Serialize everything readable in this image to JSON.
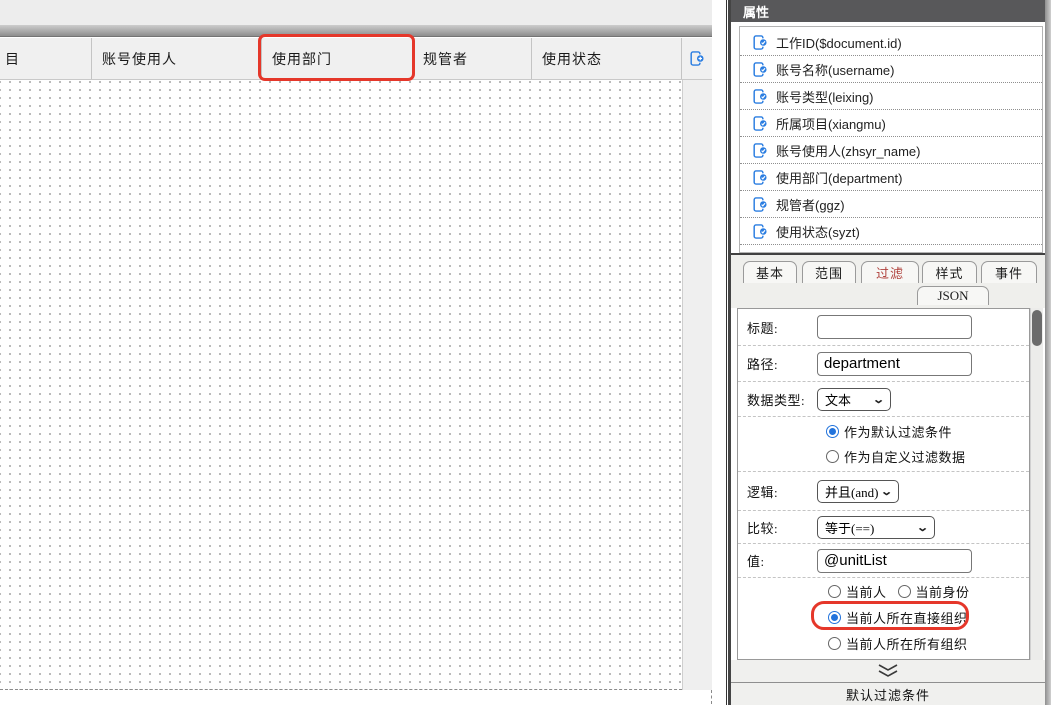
{
  "left_table": {
    "headers": [
      {
        "label": "目"
      },
      {
        "label": "账号使用人"
      },
      {
        "label": "使用部门",
        "highlighted": true
      },
      {
        "label": "规管者"
      },
      {
        "label": "使用状态"
      }
    ],
    "add_column_icon": "page-plus-icon"
  },
  "panel": {
    "title": "属性",
    "fields": [
      {
        "label": "工作ID($document.id)",
        "icon": "page-check-icon"
      },
      {
        "label": "账号名称(username)",
        "icon": "page-check-icon"
      },
      {
        "label": "账号类型(leixing)",
        "icon": "page-check-icon"
      },
      {
        "label": "所属项目(xiangmu)",
        "icon": "page-check-icon"
      },
      {
        "label": "账号使用人(zhsyr_name)",
        "icon": "page-check-icon"
      },
      {
        "label": "使用部门(department)",
        "icon": "page-check-icon"
      },
      {
        "label": "规管者(ggz)",
        "icon": "page-check-icon"
      },
      {
        "label": "使用状态(syzt)",
        "icon": "page-check-icon"
      }
    ],
    "tabs": [
      {
        "label": "基本",
        "active": false
      },
      {
        "label": "范围",
        "active": false
      },
      {
        "label": "过滤",
        "active": true
      },
      {
        "label": "样式",
        "active": false
      },
      {
        "label": "事件",
        "active": false
      },
      {
        "label": "JSON",
        "active": false
      }
    ],
    "form": {
      "title_label": "标题:",
      "title_value": "",
      "path_label": "路径:",
      "path_value": "department",
      "datatype_label": "数据类型:",
      "datatype_value": "文本",
      "filter_mode_options": [
        {
          "label": "作为默认过滤条件",
          "selected": true
        },
        {
          "label": "作为自定义过滤数据",
          "selected": false
        }
      ],
      "logic_label": "逻辑:",
      "logic_value": "并且(and)",
      "compare_label": "比较:",
      "compare_value": "等于(==)",
      "value_label": "值:",
      "value_value": "@unitList",
      "scope_options": [
        {
          "label": "当前人",
          "selected": false
        },
        {
          "label": "当前身份",
          "selected": false
        },
        {
          "label": "当前人所在直接组织",
          "selected": true
        },
        {
          "label": "当前人所在所有组织",
          "selected": false
        }
      ]
    },
    "collapse_bar_label": "默认过滤条件"
  },
  "colors": {
    "accent_blue": "#2a7de1",
    "annotation_red": "#e5372a",
    "active_tab_text": "#b0413c",
    "panel_title_bg": "#58585a"
  }
}
